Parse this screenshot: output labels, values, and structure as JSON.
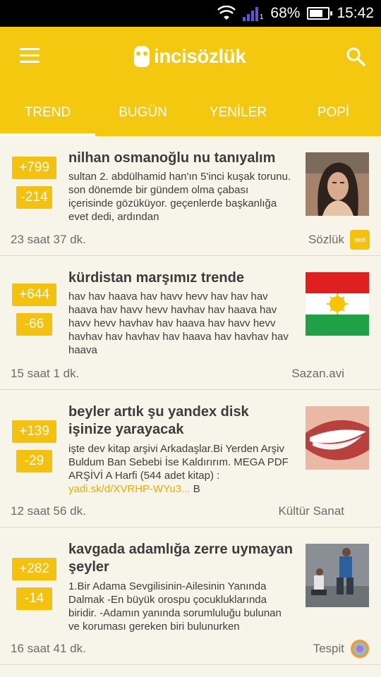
{
  "status": {
    "battery": "68%",
    "time": "15:42",
    "signal_sub": "1"
  },
  "app": {
    "name": "incisözlük"
  },
  "tabs": [
    "TREND",
    "BUGÜN",
    "YENİLER",
    "POPİ"
  ],
  "posts": [
    {
      "up": "+799",
      "down": "-214",
      "title": "nilhan osmanoğlu nu tanıyalım",
      "excerpt": "sultan 2. abdülhamid han'ın 5'inci kuşak torunu. son dönemde bir gündem olma çabası içerisinde gözüküyor. geçenlerde başkanlığa evet dedi, ardından",
      "time": "23 saat 37 dk.",
      "channel": "Sözlük",
      "channel_icon_text": "inci"
    },
    {
      "up": "+644",
      "down": "-66",
      "title": "kürdistan marşımız trende",
      "excerpt": "hav hav haava hav havv hevv hav hav hav haava hav havv hevv havhav hav haava hav havv hevv havhav hav haava hav havv hevv havhav hav havhav hav haava hav havhav hav haava",
      "time": "15 saat 1 dk.",
      "channel": "Sazan.avi"
    },
    {
      "up": "+139",
      "down": "-29",
      "title": "beyler artık şu yandex disk işinize yarayacak",
      "excerpt": "işte dev kitap arşivi Arkadaşlar.Bi Yerden Arşiv Buldum Ban Sebebi İse Kaldırırım. MEGA PDF ARŞİVİ A Harfi (544 adet kitap) :",
      "link": "yadi.sk/d/XVRHP-WYu3...",
      "link_tail": " B",
      "time": "12 saat 56 dk.",
      "channel": "Kültür Sanat"
    },
    {
      "up": "+282",
      "down": "-14",
      "title": "kavgada adamlığa zerre uymayan şeyler",
      "excerpt": "1.Bir Adama Sevgilisinin-Ailesinin Yanında Dalmak -En büyük orospu çocukluklarında biridir. -Adamın yanında sorumluluğu bulunan ve koruması gereken biri bulunurken",
      "time": "16 saat 41 dk.",
      "channel": "Tespit"
    }
  ],
  "colors": {
    "accent": "#f5c810",
    "vote": "#f4c20d",
    "background": "#f7f4ea"
  },
  "icons": [
    "menu-icon",
    "search-icon",
    "wifi-icon",
    "signal-icon",
    "battery-icon",
    "owl-logo-icon",
    "inci-channel-icon",
    "tespit-channel-icon"
  ]
}
